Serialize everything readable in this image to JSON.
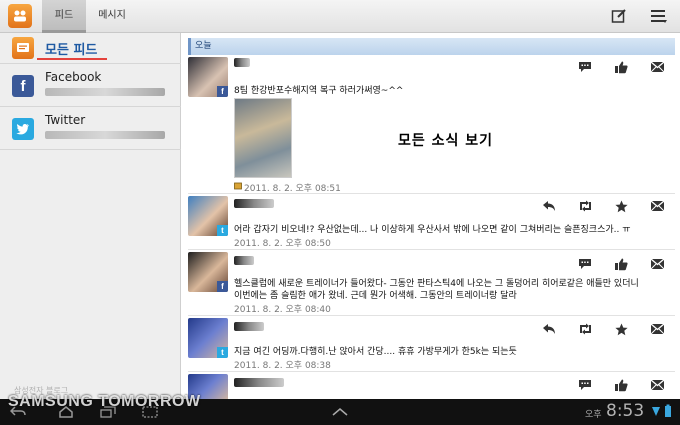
{
  "topbar": {
    "tabs": [
      {
        "label": "피드",
        "active": true
      },
      {
        "label": "메시지",
        "active": false
      }
    ],
    "compose_icon": "compose-icon",
    "menu_icon": "menu-icon"
  },
  "sidebar": {
    "items": [
      {
        "label": "모든 피드",
        "icon": "feed-icon"
      },
      {
        "label": "Facebook",
        "icon": "facebook-icon"
      },
      {
        "label": "Twitter",
        "icon": "twitter-icon"
      }
    ]
  },
  "main": {
    "day_header": "오늘",
    "annotation": "모든 소식 보기",
    "posts": [
      {
        "network": "facebook",
        "text": "8팀 한강반포수해지역 복구 하러가써영~^^",
        "time": "2011. 8. 2. 오후 08:51",
        "actions": [
          "comment-icon",
          "like-icon",
          "share-icon"
        ]
      },
      {
        "network": "twitter",
        "text": "어라 갑자기 비오네!? 우산없는데... 나 이상하게 우산사서 밖에 나오면 같이 그쳐버리는 슬픈징크스가.. ㅠ",
        "time": "2011. 8. 2. 오후 08:50",
        "actions": [
          "reply-icon",
          "retweet-icon",
          "star-icon",
          "share-icon"
        ]
      },
      {
        "network": "facebook",
        "text": "헬스클럽에 새로운 트레이너가 들어왔다- 그동안 판타스틱4에 나오는 그 돌덩어리 히어로같은 애들만 있더니",
        "text2": "이번에는 좀 슬림한 애가 왔네. 근데 뭔가 어색해. 그동안의 트레이너랑 달라",
        "time": "2011. 8. 2. 오후 08:40",
        "actions": [
          "comment-icon",
          "like-icon",
          "share-icon"
        ]
      },
      {
        "network": "twitter",
        "text": "지금 여긴 어딩까.다행히.난 앉아서 간당.... 휴휴 가방무게가 한5k는 되는듯",
        "time": "2011. 8. 2. 오후 08:38",
        "actions": [
          "reply-icon",
          "retweet-icon",
          "star-icon",
          "share-icon"
        ]
      },
      {
        "network": "facebook",
        "actions": [
          "comment-icon",
          "like-icon",
          "share-icon"
        ]
      }
    ]
  },
  "systembar": {
    "ampm": "오후",
    "time": "8:53"
  },
  "watermark": {
    "main": "SAMSUNG TOMORROW",
    "small": "삼성전자 블로그"
  },
  "colors": {
    "accent_blue": "#1f5aa3",
    "facebook": "#3b5998",
    "twitter": "#2aa9e0",
    "underline_red": "#e4423c",
    "header_blue": "#bcd3ec"
  }
}
